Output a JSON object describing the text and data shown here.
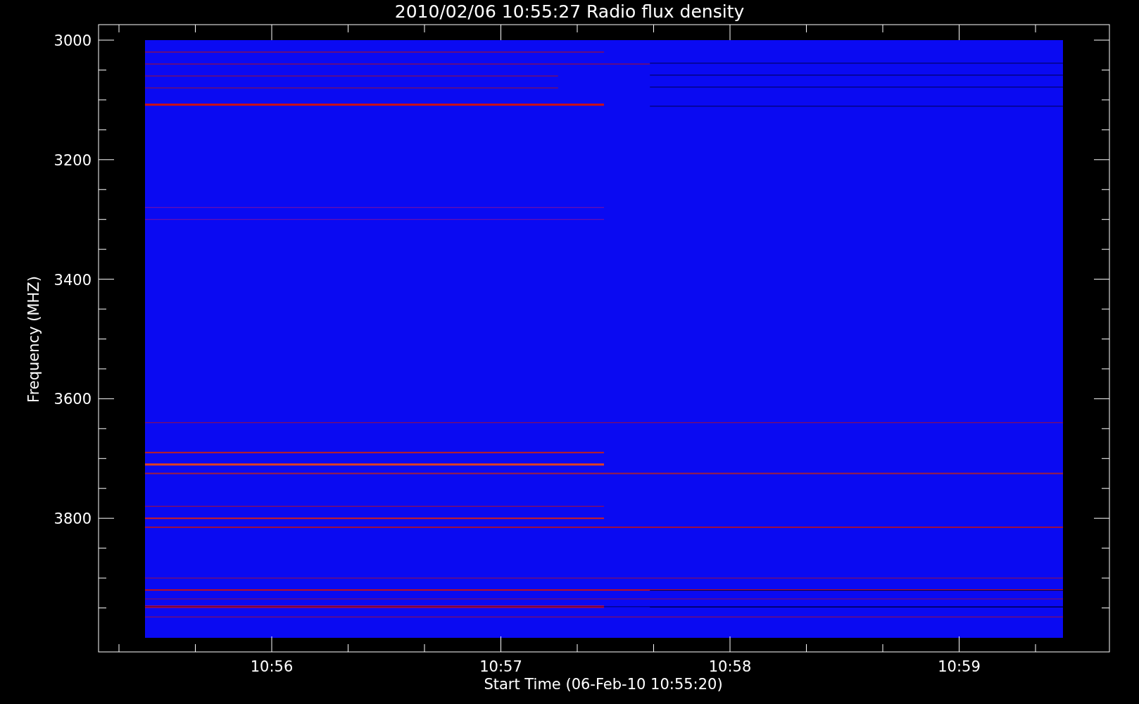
{
  "title": "2010/02/06 10:55:27 Radio flux density",
  "y_axis": {
    "label": "Frequency (MHZ)",
    "ticks": [
      "3000",
      "3200",
      "3400",
      "3600",
      "3800"
    ]
  },
  "x_axis": {
    "label": "Start Time (06-Feb-10 10:55:20)",
    "ticks": [
      "10:56",
      "10:57",
      "10:58",
      "10:59"
    ]
  }
}
